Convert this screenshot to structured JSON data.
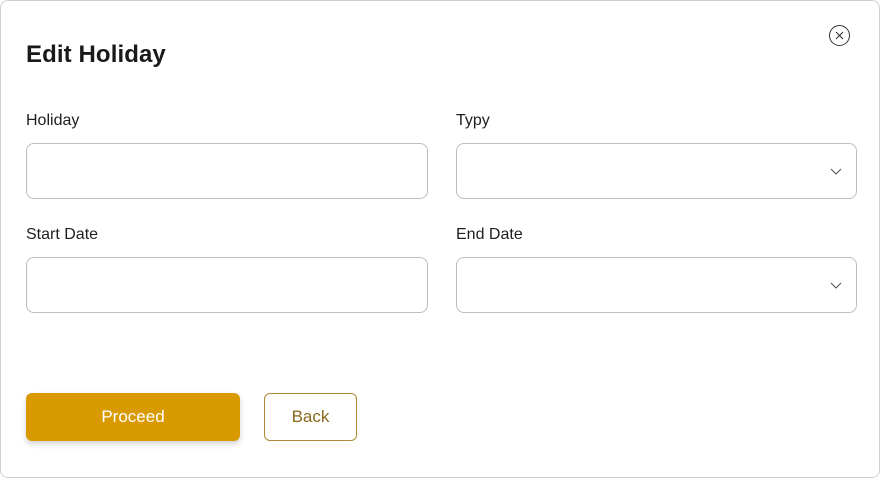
{
  "modal": {
    "title": "Edit Holiday",
    "close_icon": "close-icon"
  },
  "form": {
    "holiday": {
      "label": "Holiday",
      "value": "",
      "placeholder": ""
    },
    "type": {
      "label": "Typy",
      "value": "",
      "icon": "chevron-down-icon"
    },
    "start_date": {
      "label": "Start Date",
      "value": "",
      "placeholder": ""
    },
    "end_date": {
      "label": "End Date",
      "value": "",
      "icon": "chevron-down-icon"
    }
  },
  "actions": {
    "proceed_label": "Proceed",
    "back_label": "Back"
  },
  "colors": {
    "accent": "#d99a00",
    "secondary_border": "#b08a3a",
    "secondary_text": "#8a6a1a",
    "field_border": "#bdbdbd"
  }
}
